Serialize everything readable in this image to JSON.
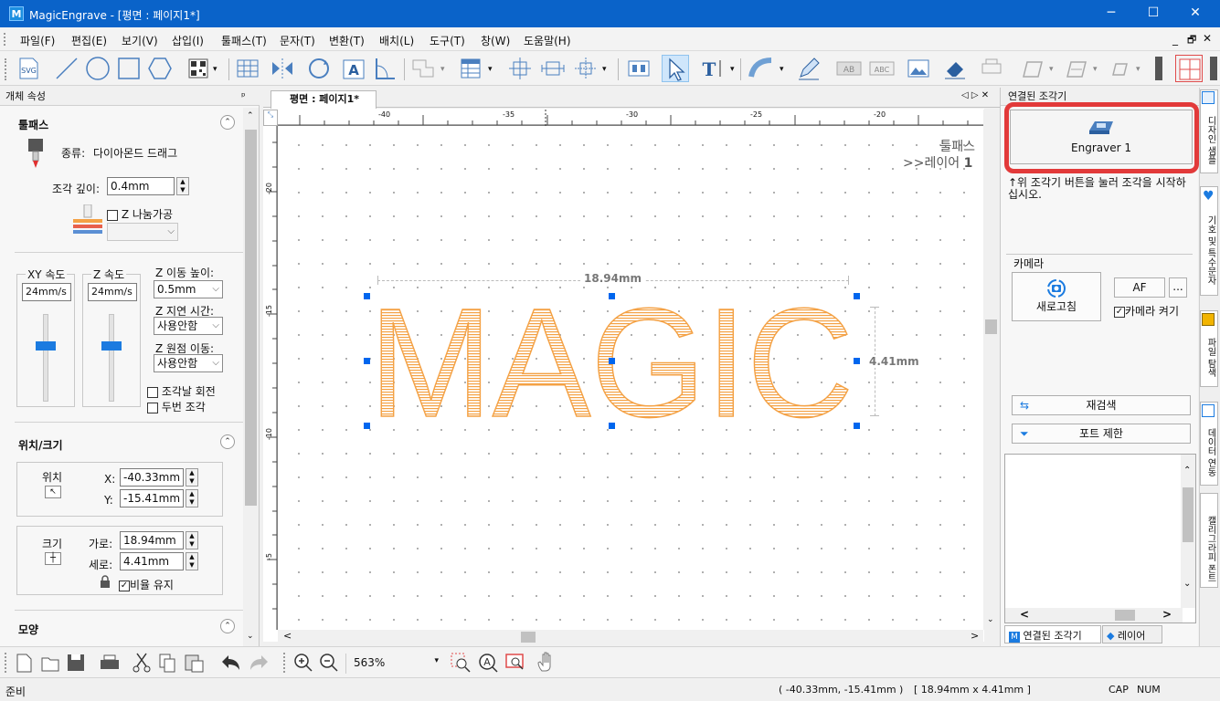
{
  "window": {
    "app_title": "MagicEngrave - [평면 : 페이지1*]",
    "logo": "M"
  },
  "window_controls": {
    "minimize": "─",
    "maximize": "☐",
    "close": "✕"
  },
  "mdi_controls": {
    "minimize": "_",
    "restore": "🗗",
    "close": "✕"
  },
  "menu": [
    "파일(F)",
    "편집(E)",
    "보기(V)",
    "삽입(I)",
    "툴패스(T)",
    "문자(T)",
    "변환(T)",
    "배치(L)",
    "도구(T)",
    "창(W)",
    "도움말(H)"
  ],
  "toolbar": {
    "svg_label": "SVG",
    "ab1": "AB",
    "ab2": "ABC"
  },
  "left_panel": {
    "header": "개체 속성",
    "pin": "ᅟ",
    "toolpath": {
      "title": "툴패스",
      "type_label": "종류:",
      "type_value": "다이아몬드 드래그",
      "depth_label": "조각 깊이:",
      "depth_value": "0.4mm",
      "z_split_label": "Z 나눔가공"
    },
    "speed": {
      "xy_label": "XY 속도",
      "xy_value": "24mm/s",
      "z_label": "Z 속도",
      "z_value": "24mm/s",
      "z_move_height_label": "Z 이동 높이:",
      "z_move_height_value": "0.5mm",
      "z_delay_label": "Z 지연 시간:",
      "z_delay_value": "사용안함",
      "z_origin_label": "Z 원점 이동:",
      "z_origin_value": "사용안함",
      "rotate_label": "조각날 회전",
      "twice_label": "두번 조각"
    },
    "position_size": {
      "title": "위치/크기",
      "pos_label": "위치",
      "x_label": "X:",
      "x_value": "-40.33mm",
      "y_label": "Y:",
      "y_value": "-15.41mm",
      "size_label": "크기",
      "w_label": "가로:",
      "w_value": "18.94mm",
      "h_label": "세로:",
      "h_value": "4.41mm",
      "keep_ratio_label": "비율 유지"
    },
    "shape": {
      "title": "모양"
    }
  },
  "doc": {
    "tab_label": "평면 : 페이지1*",
    "tab_nav": "◁ ▷ ✕",
    "ruler_top": [
      "-40",
      "-35",
      "-30",
      "-25",
      "-20"
    ],
    "ruler_left": [
      "-20",
      "-15",
      "-10",
      "-5"
    ],
    "layer_line1": "툴패스",
    "layer_line2_prefix": ">>레이어",
    "layer_line2_num": "1",
    "text": "MAGIC",
    "width_dim": "18.94mm",
    "height_dim": "4.41mm"
  },
  "right_panel": {
    "header": "연결된 조각기",
    "engraver_button": "Engraver 1",
    "instruction": "↑위 조각기 버튼을 눌러 조각을 시작하십시오.",
    "camera_label": "카메라",
    "refresh_label": "새로고침",
    "af_label": "AF",
    "more_label": "...",
    "camera_on_label": "카메라 켜기",
    "rescan_label": "재검색",
    "port_limit_label": "포트 제한",
    "tab_connected": "연결된 조각기",
    "tab_layer": "레이어"
  },
  "side_tabs": [
    "디자인 샘플",
    "기호 및 특수문자",
    "파일 탐색",
    "데이터 연동",
    "캘리그라피 폰트"
  ],
  "bottom_toolbar": {
    "zoom_value": "563%"
  },
  "status": {
    "left": "준비",
    "coords": "( -40.33mm, -15.41mm )",
    "size": "[ 18.94mm x 4.41mm ]",
    "cap": "CAP",
    "num": "NUM"
  },
  "colors": {
    "title_bar": "#0a63c9",
    "text_orange": "#f4a144",
    "handle_blue": "#0066ee",
    "highlight_red": "#e23a3a"
  }
}
